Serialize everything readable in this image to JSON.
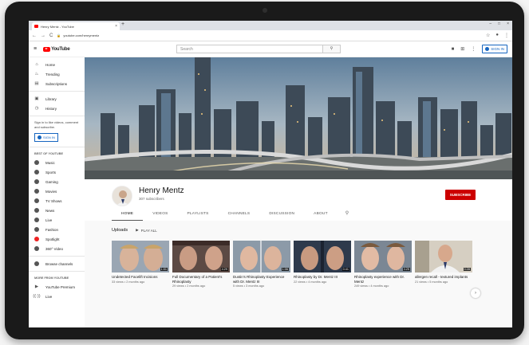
{
  "browser": {
    "tab_title": "Henry Mentz - YouTube",
    "tab_close": "×",
    "new_tab": "+",
    "url": "youtube.com/henrymentz",
    "window_controls": [
      "–",
      "□",
      "×"
    ]
  },
  "header": {
    "logo_text": "YouTube",
    "search_placeholder": "Search",
    "signin_label": "SIGN IN"
  },
  "sidebar": {
    "items": [
      {
        "label": "Home",
        "icon": "home-icon"
      },
      {
        "label": "Trending",
        "icon": "flame-icon"
      },
      {
        "label": "Subscriptions",
        "icon": "subscriptions-icon"
      }
    ],
    "items2": [
      {
        "label": "Library",
        "icon": "library-icon"
      },
      {
        "label": "History",
        "icon": "history-icon"
      }
    ],
    "signin_note": "Sign in to like videos, comment and subscribe.",
    "signin_label": "SIGN IN",
    "best_of_heading": "BEST OF YOUTUBE",
    "best_of": [
      "Music",
      "Sports",
      "Gaming",
      "Movies",
      "TV Shows",
      "News",
      "Live",
      "Fashion",
      "Spotlight",
      "360° Video"
    ],
    "browse_channels": "Browse channels",
    "more_heading": "MORE FROM YOUTUBE",
    "more": [
      "YouTube Premium",
      "Live"
    ]
  },
  "channel": {
    "name": "Henry Mentz",
    "subscribers": "307 subscribers",
    "subscribe_label": "SUBSCRIBE",
    "tabs": [
      "HOME",
      "VIDEOS",
      "PLAYLISTS",
      "CHANNELS",
      "DISCUSSION",
      "ABOUT"
    ],
    "active_tab": "HOME"
  },
  "uploads": {
    "title": "Uploads",
    "play_all": "PLAY ALL",
    "videos": [
      {
        "title": "Undetected Facelift Incisions",
        "meta": "33 views • 2 months ago",
        "duration": "1:01"
      },
      {
        "title": "Full Documentary of a Patient's Rhinoplasty",
        "meta": "29 views • 2 months ago",
        "duration": "4:29"
      },
      {
        "title": "Dustin's Rhinoplasty Experience with Dr. Mentz III",
        "meta": "5 views • 3 months ago",
        "duration": "1:06"
      },
      {
        "title": "Rhinoplasty by Dr. Mentz III",
        "meta": "22 views • 4 months ago",
        "duration": "0:41"
      },
      {
        "title": "Rhinoplasty experience with Dr. Mentz",
        "meta": "249 views • 4 months ago",
        "duration": "3:25"
      },
      {
        "title": "allergen recall - textured implants",
        "meta": "21 views • 5 months ago",
        "duration": "0:28"
      }
    ]
  },
  "colors": {
    "youtube_red": "#ff0000",
    "subscribe_red": "#cc0000",
    "signin_blue": "#1565c0"
  }
}
